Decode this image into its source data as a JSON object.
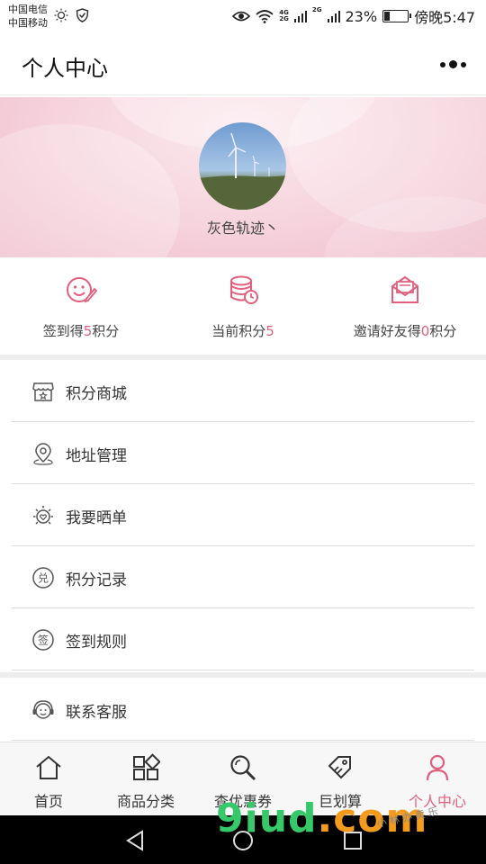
{
  "status_bar": {
    "carrier_1": "中国电信",
    "carrier_2": "中国移动",
    "net_1": "4G",
    "net_2": "2G",
    "net_3": "2G",
    "battery_percent": "23%",
    "battery_level": 0.23,
    "time": "傍晚5:47"
  },
  "nav": {
    "title": "个人中心"
  },
  "profile": {
    "username": "灰色轨迹丶"
  },
  "stats": [
    {
      "prefix": "签到得",
      "value": "5",
      "suffix": "积分",
      "icon": "smile-pen-icon"
    },
    {
      "prefix": "当前积分",
      "value": "5",
      "suffix": "",
      "icon": "coins-icon"
    },
    {
      "prefix": "邀请好友得",
      "value": "0",
      "suffix": "积分",
      "icon": "envelope-icon"
    }
  ],
  "menu": [
    {
      "label": "积分商城",
      "icon": "store-icon"
    },
    {
      "label": "地址管理",
      "icon": "location-pin-icon"
    },
    {
      "label": "我要晒单",
      "icon": "sun-heart-icon"
    },
    {
      "label": "积分记录",
      "icon": "exchange-circle-icon"
    },
    {
      "label": "签到规则",
      "icon": "sign-circle-icon"
    },
    {
      "label": "联系客服",
      "icon": "customer-service-icon"
    }
  ],
  "tabs": [
    {
      "label": "首页",
      "icon": "home-icon",
      "active": false
    },
    {
      "label": "商品分类",
      "icon": "category-grid-icon",
      "active": false
    },
    {
      "label": "查优惠券",
      "icon": "search-icon",
      "active": false
    },
    {
      "label": "巨划算",
      "icon": "tag-icon",
      "active": false
    },
    {
      "label": "个人中心",
      "icon": "user-icon",
      "active": true
    }
  ],
  "watermark": {
    "part_1": "9iud",
    "part_2": ".com",
    "small": "小 林 办 卖 乐"
  },
  "colors": {
    "accent": "#e0607e",
    "banner": "#f6d3dd"
  }
}
